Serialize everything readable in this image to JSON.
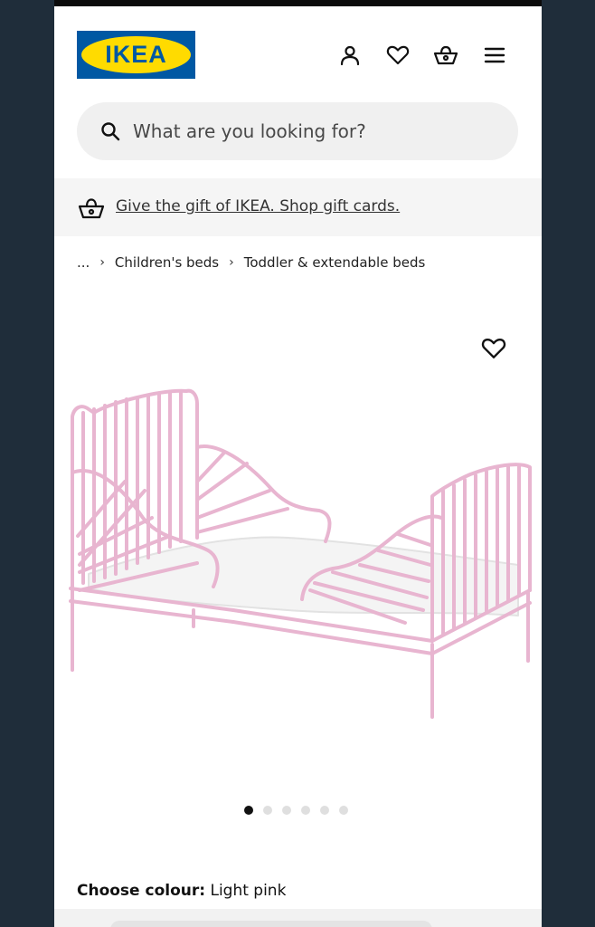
{
  "header": {
    "logo_text": "IKEA",
    "logo_reg": "®",
    "icons": [
      "user-icon",
      "heart-icon",
      "basket-icon",
      "menu-icon"
    ]
  },
  "search": {
    "placeholder": "What are you looking for?"
  },
  "banner": {
    "link": "Give the gift of IKEA. Shop gift cards."
  },
  "breadcrumb": {
    "items": [
      "...",
      "Children's beds",
      "Toddler & extendable beds"
    ],
    "separator": "›"
  },
  "product": {
    "image_dots": 6,
    "active_dot": 0,
    "colour_label": "Choose colour:",
    "colour_value": "Light pink"
  },
  "colors": {
    "ikea_blue": "#0058a3",
    "ikea_yellow": "#ffdb00",
    "bed_pink": "#e9b3cf",
    "frame_dark": "#1f2d3a"
  }
}
